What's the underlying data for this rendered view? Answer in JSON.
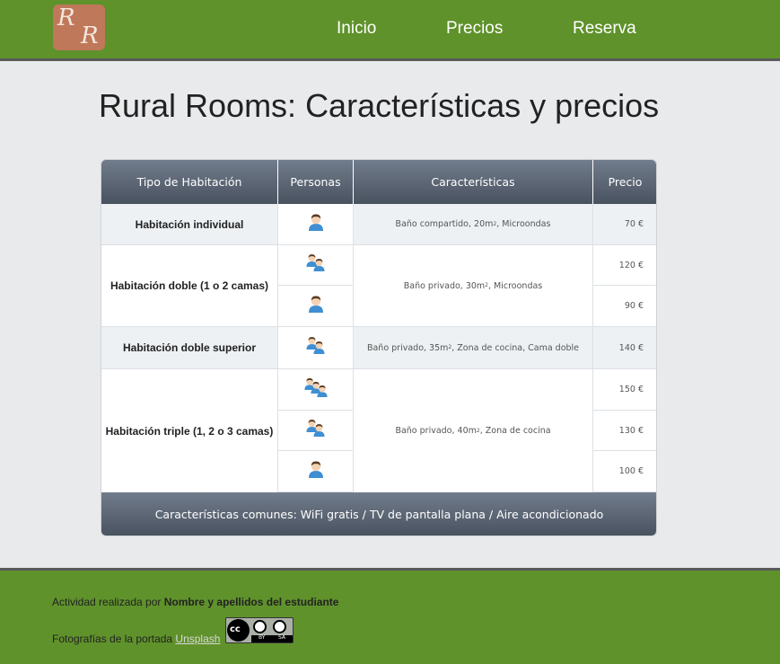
{
  "header": {
    "logo_top": "R",
    "logo_bottom": "R",
    "nav": [
      "Inicio",
      "Precios",
      "Reserva"
    ]
  },
  "page_title": "Rural Rooms: Características y precios",
  "table": {
    "headers": [
      "Tipo de Habitación",
      "Personas",
      "Características",
      "Precio"
    ],
    "rooms": [
      {
        "name": "Habitación individual",
        "features": "Baño compartido, 20m",
        "features_sup": "2",
        "features_rest": ", Microondas",
        "rows": [
          {
            "persons": 1,
            "price": "70 €"
          }
        ]
      },
      {
        "name": "Habitación doble (1 o 2 camas)",
        "features": "Baño privado, 30m",
        "features_sup": "2",
        "features_rest": ", Microondas",
        "rows": [
          {
            "persons": 2,
            "price": "120 €"
          },
          {
            "persons": 1,
            "price": "90 €"
          }
        ]
      },
      {
        "name": "Habitación doble superior",
        "features": "Baño privado, 35m",
        "features_sup": "2",
        "features_rest": ", Zona de cocina, Cama doble",
        "rows": [
          {
            "persons": 2,
            "price": "140 €"
          }
        ]
      },
      {
        "name": "Habitación triple (1, 2 o 3 camas)",
        "features": "Baño privado, 40m",
        "features_sup": "2",
        "features_rest": ", Zona de cocina",
        "rows": [
          {
            "persons": 3,
            "price": "150 €"
          },
          {
            "persons": 2,
            "price": "130 €"
          },
          {
            "persons": 1,
            "price": "100 €"
          }
        ]
      }
    ],
    "footer": "Características comunes: WiFi gratis / TV de pantalla plana / Aire acondicionado"
  },
  "footer": {
    "credit_prefix": "Actividad realizada por ",
    "credit_name": "Nombre y apellidos del estudiante",
    "photos_prefix": "Fotografías de la portada ",
    "photos_link": "Unsplash",
    "license_badge": {
      "cc": "cc",
      "by": "BY",
      "sa": "SA"
    }
  },
  "icons": {
    "person": "person-icon",
    "license": "cc-by-sa-icon"
  },
  "colors": {
    "header_green": "#5f922b",
    "table_header": "#5b6574",
    "logo": "#c0785a"
  }
}
